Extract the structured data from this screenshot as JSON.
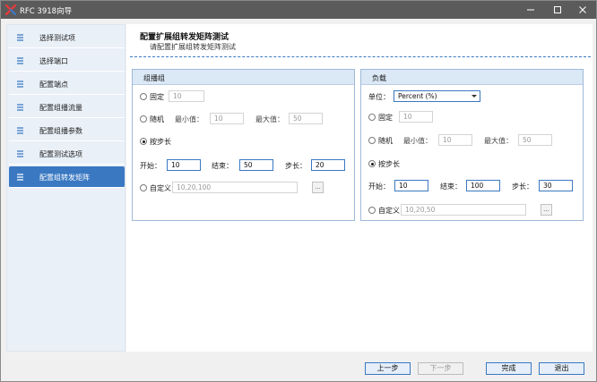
{
  "window": {
    "title": "RFC 3918向导",
    "icon": "app-logo-icon",
    "controls": [
      "minimize-icon",
      "maximize-icon",
      "close-icon"
    ]
  },
  "sidebar": {
    "items": [
      {
        "label": "选择测试项",
        "active": false
      },
      {
        "label": "选择端口",
        "active": false
      },
      {
        "label": "配置端点",
        "active": false
      },
      {
        "label": "配置组播流量",
        "active": false
      },
      {
        "label": "配置组播参数",
        "active": false
      },
      {
        "label": "配置测试选项",
        "active": false
      },
      {
        "label": "配置组转发矩阵",
        "active": true
      }
    ]
  },
  "header": {
    "title": "配置扩展组转发矩阵测试",
    "subtitle": "请配置扩展组转发矩阵测试"
  },
  "multicast_group": {
    "title": "组播组",
    "fixed_label": "固定",
    "fixed_value": "10",
    "random_label": "随机",
    "min_label": "最小值：",
    "min_value": "10",
    "max_label": "最大值：",
    "max_value": "50",
    "step_label": "按步长",
    "start_label": "开始：",
    "start_value": "10",
    "end_label": "结束：",
    "end_value": "50",
    "step_size_label": "步长：",
    "step_size_value": "20",
    "custom_label": "自定义",
    "custom_value": "10,20,100",
    "custom_button": "...",
    "selected": "step"
  },
  "load": {
    "title": "负载",
    "unit_label": "单位：",
    "unit_value": "Percent (%)",
    "fixed_label": "固定",
    "fixed_value": "10",
    "random_label": "随机",
    "min_label": "最小值：",
    "min_value": "10",
    "max_label": "最大值：",
    "max_value": "50",
    "step_label": "按步长",
    "start_label": "开始：",
    "start_value": "10",
    "end_label": "结束：",
    "end_value": "100",
    "step_size_label": "步长：",
    "step_size_value": "30",
    "custom_label": "自定义",
    "custom_value": "10,20,50",
    "custom_button": "...",
    "selected": "step"
  },
  "footer": {
    "prev_label": "上一步",
    "next_label": "下一步",
    "finish_label": "完成",
    "exit_label": "退出"
  },
  "colors": {
    "titlebar": "#5b5b5b",
    "accent": "#3a78c2",
    "sidebar_bg": "#e9f0f8",
    "group_header": "#dbe8f6"
  }
}
